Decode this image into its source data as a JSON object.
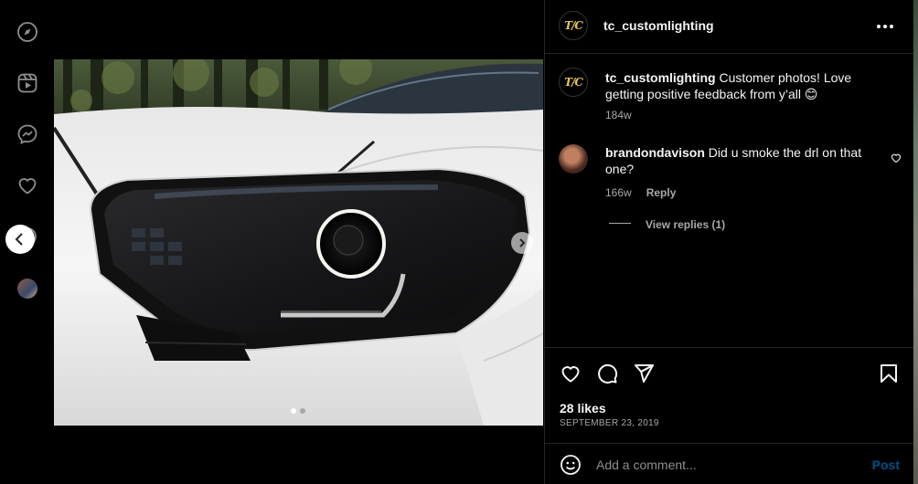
{
  "rail": {
    "icons": [
      "compass-icon",
      "reels-icon",
      "messenger-icon",
      "heart-icon",
      "threads-icon"
    ]
  },
  "post": {
    "username": "tc_customlighting",
    "avatar_initials": "T/C",
    "caption": {
      "username": "tc_customlighting",
      "text": "Customer photos! Love getting positive feedback from y’all 😊",
      "age": "184w"
    },
    "comments": [
      {
        "username": "brandondavison",
        "text": "Did u smoke the drl on that one?",
        "age": "166w",
        "reply_label": "Reply",
        "view_replies": "View replies (1)"
      }
    ],
    "likes": "28 likes",
    "date": "SEPTEMBER 23, 2019",
    "carousel": {
      "total": 2,
      "current": 1
    }
  },
  "composer": {
    "placeholder": "Add a comment...",
    "post_label": "Post"
  },
  "colors": {
    "background": "#000000",
    "text": "#f5f5f5",
    "secondary": "#a8a8a8",
    "accent": "#0095f6",
    "logo": "#e3c84f"
  }
}
